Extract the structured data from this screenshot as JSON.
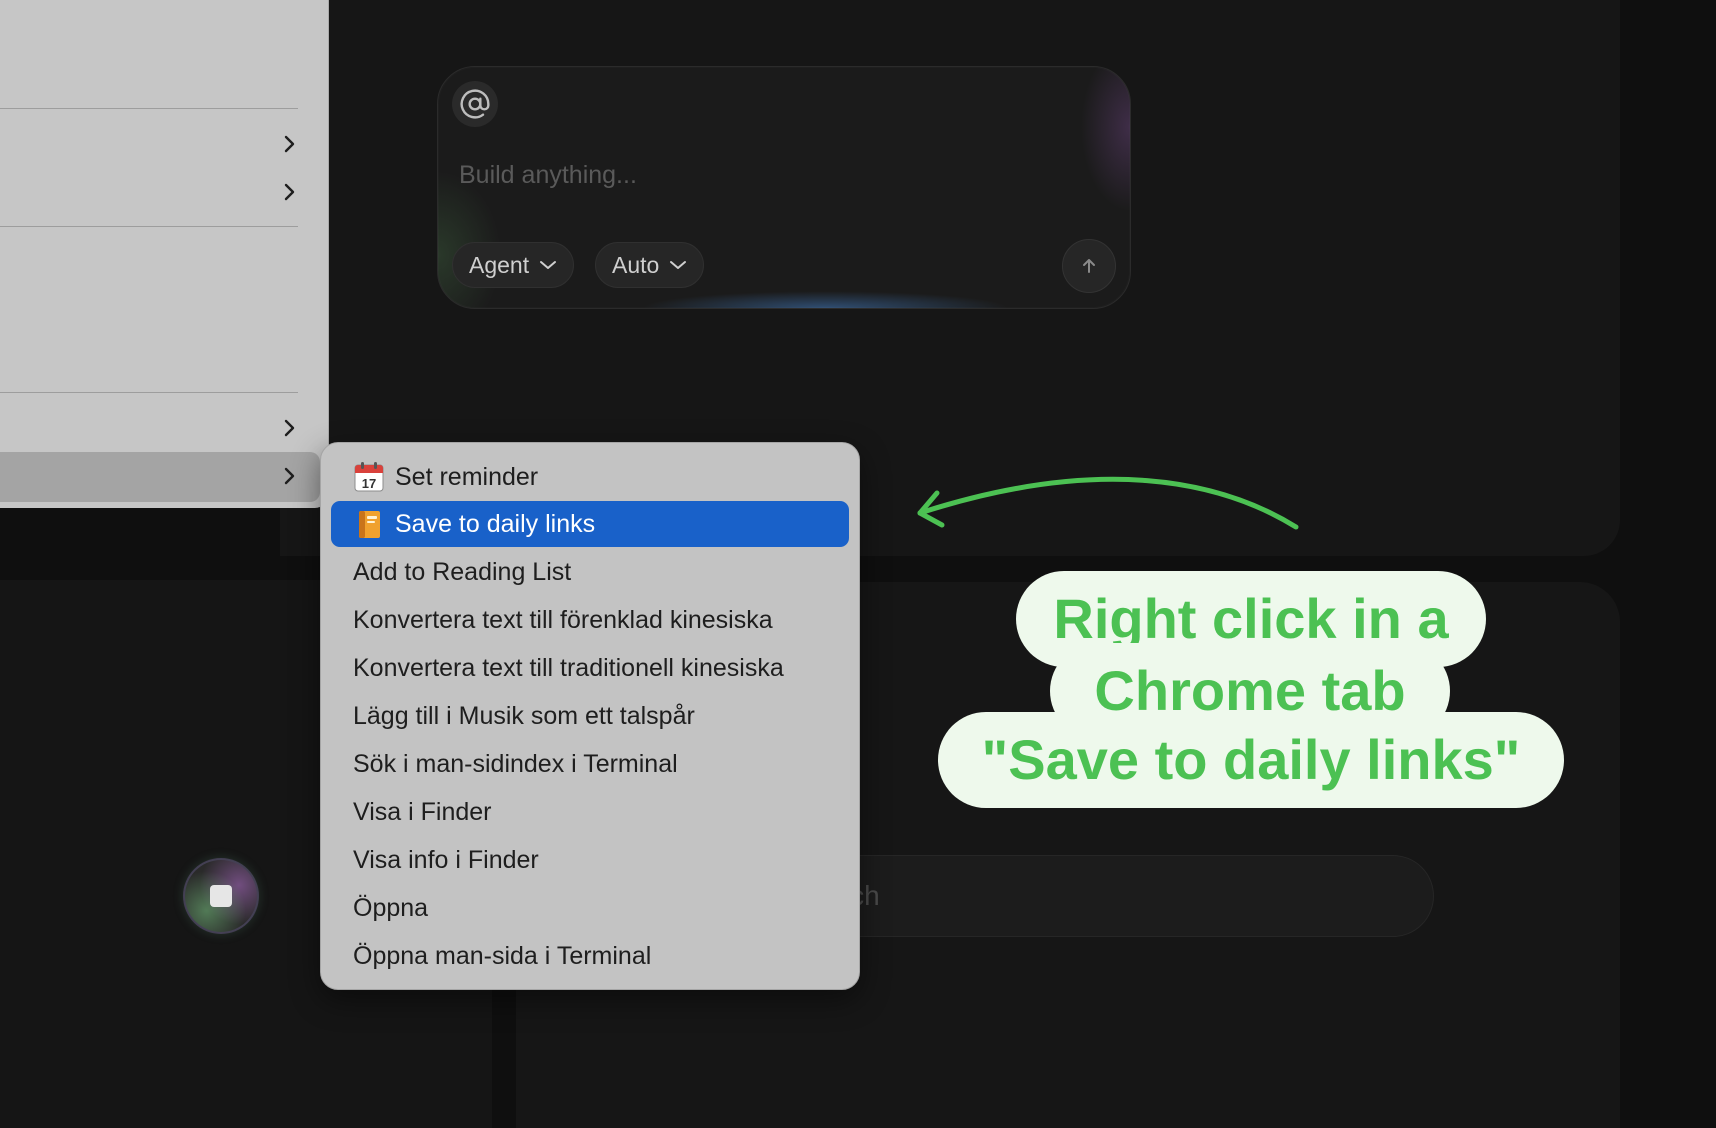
{
  "composer": {
    "placeholder": "Build anything...",
    "mode_label": "Agent",
    "model_label": "Auto",
    "mention_icon": "at-sign-icon",
    "send_icon": "arrow-up-icon"
  },
  "search": {
    "placeholder": "Search"
  },
  "context_menu": {
    "items": [
      {
        "label": "Set reminder",
        "icon": "calendar-icon"
      },
      {
        "label": "Save to daily links",
        "icon": "book-icon",
        "highlighted": true
      },
      {
        "label": "Add to Reading List"
      },
      {
        "label": "Konvertera text till förenklad kinesiska"
      },
      {
        "label": "Konvertera text till traditionell kinesiska"
      },
      {
        "label": "Lägg till i Musik som ett talspår"
      },
      {
        "label": "Sök i man-sidindex i Terminal"
      },
      {
        "label": "Visa i Finder"
      },
      {
        "label": "Visa info i Finder"
      },
      {
        "label": "Öppna"
      },
      {
        "label": "Öppna man-sida i Terminal"
      }
    ]
  },
  "calendar_icon_day": "17",
  "annotation": {
    "line1": "Right click in a",
    "line2": "Chrome tab",
    "line3": "\"Save to daily links\""
  },
  "colors": {
    "highlight": "#1961c9",
    "annotation_green": "#4cc153",
    "annotation_bg": "#eef9ec"
  }
}
